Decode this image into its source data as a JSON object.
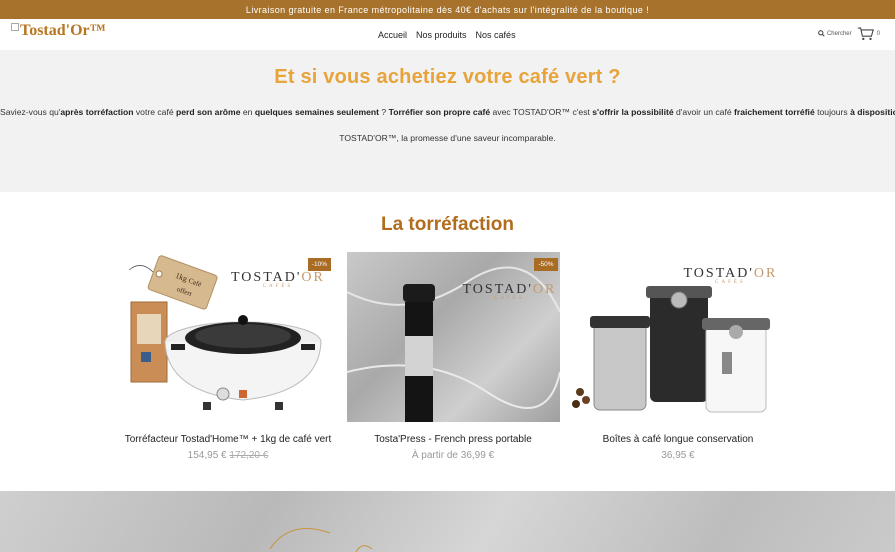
{
  "promo": {
    "text": "Livraison gratuite en France métropolitaine dès 40€ d'achats sur l'intégralité de la boutique !"
  },
  "header": {
    "logo_text": "Tostad'Or™",
    "nav": [
      "Accueil",
      "Nos produits",
      "Nos cafés"
    ],
    "search_label": "Chercher",
    "cart_count": "0"
  },
  "intro": {
    "title": "Et si vous achetiez votre café vert ?",
    "para": {
      "p1": "Saviez-vous qu'",
      "b1": "après torréfaction",
      "p2": " votre café ",
      "b2": "perd son arôme",
      "p3": " en ",
      "b3": "quelques semaines seulement",
      "p4": " ? ",
      "b4": "Torréfier son propre café",
      "p5": " avec TOSTAD'OR™ c'est ",
      "b5": "s'offrir la possibilité",
      "p6": " d'avoir un café ",
      "b6": "fraichement torréfié",
      "p7": " toujours ",
      "b7": "à disposition",
      "p8": " !"
    },
    "tagline": "TOSTAD'OR™, la promesse d'une saveur incomparable."
  },
  "section_title": "La torréfaction",
  "products": [
    {
      "name": "Torréfacteur Tostad'Home™ + 1kg de café vert",
      "price": "154,95 €",
      "old_price": "172,20 €",
      "badge": "-10%",
      "tag_text_1": "1kg",
      "tag_text_2": "Café",
      "tag_text_3": "offert"
    },
    {
      "name": "Tosta'Press - French press portable",
      "price_prefix": "À partir de",
      "price": "36,99 €",
      "badge": "-50%"
    },
    {
      "name": "Boîtes à café longue conservation",
      "price": "36,95 €"
    }
  ],
  "brand_watermark": {
    "main": "TOSTAD'",
    "or": "OR",
    "sub": "CAFÉS"
  },
  "colors": {
    "promo_bg": "#a7722c",
    "accent_title": "#e8a33a",
    "section_title": "#b16d1d",
    "badge": "#a96c24"
  }
}
